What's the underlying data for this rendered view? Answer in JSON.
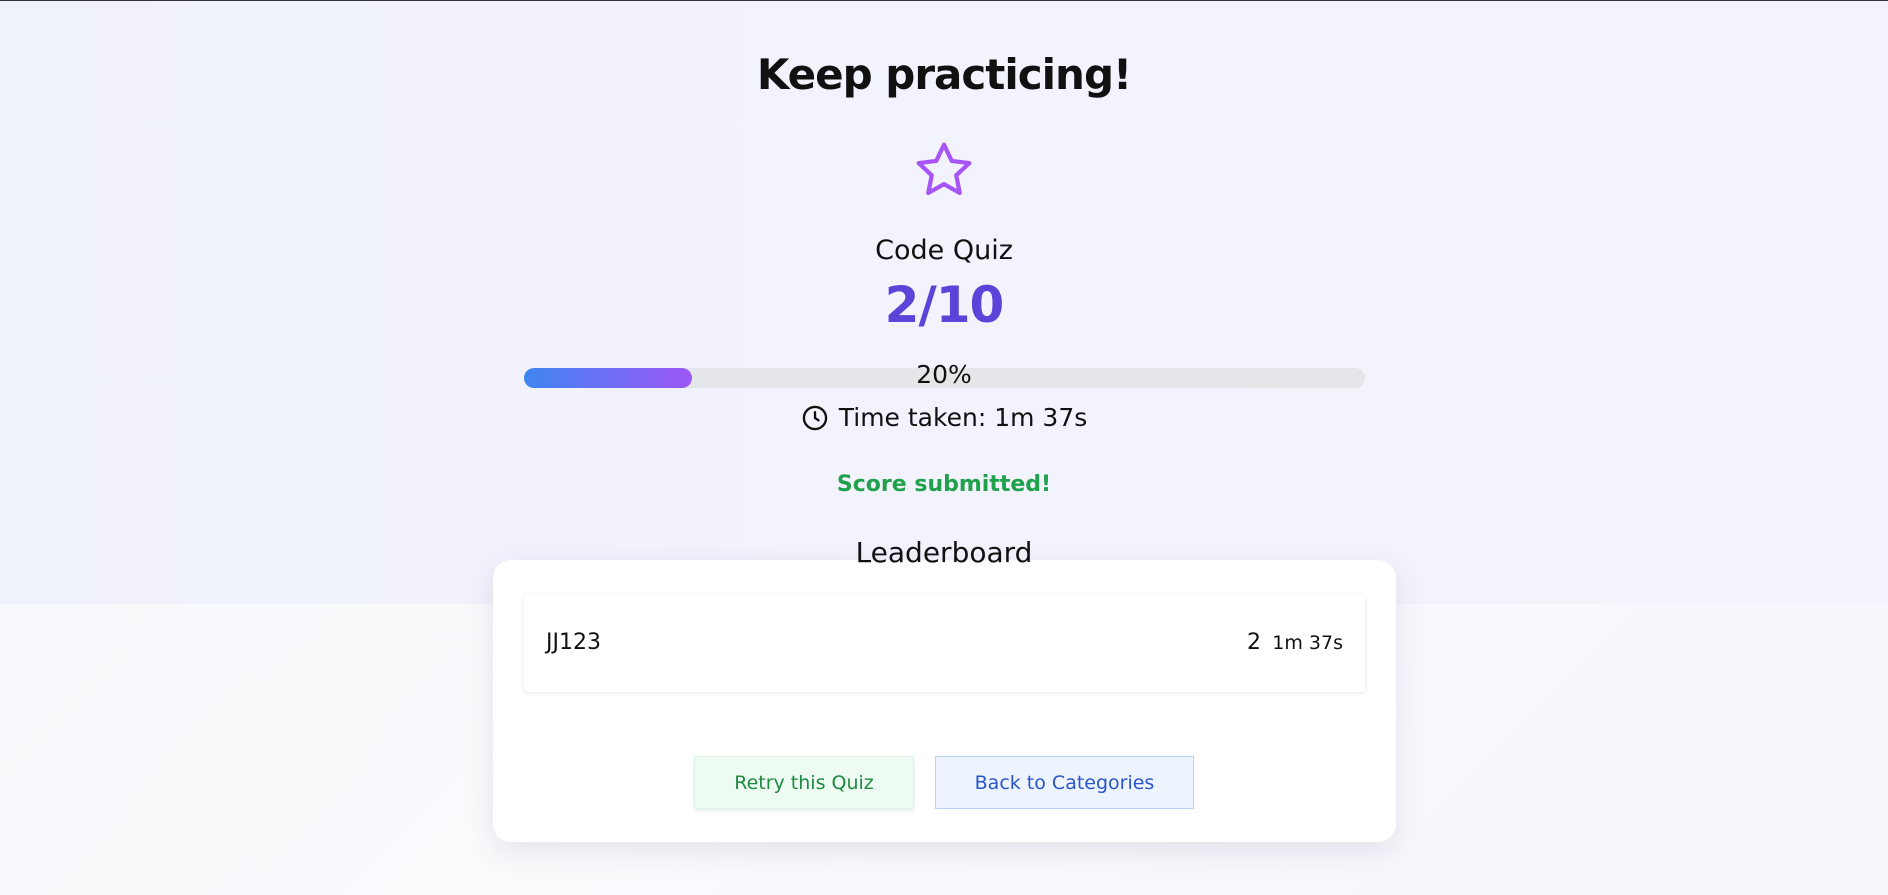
{
  "result": {
    "headline": "Keep practicing!",
    "icon": "star-icon",
    "quiz_title": "Code Quiz",
    "score_text": "2/10",
    "progress": {
      "percent": 20,
      "label": "20%"
    },
    "time_prefix": "Time taken:",
    "time_value": "1m 37s",
    "status": "Score submitted!"
  },
  "leaderboard": {
    "title": "Leaderboard",
    "rows": [
      {
        "name": "JJ123",
        "score": "2",
        "time": "1m 37s"
      }
    ]
  },
  "actions": {
    "retry_label": "Retry this Quiz",
    "back_label": "Back to Categories"
  },
  "colors": {
    "accent": "#5b45d9",
    "star": "#a855f7",
    "success": "#1fa24b",
    "progress_start": "#3f86f3",
    "progress_end": "#9d57f5",
    "retry_text": "#1f8a42",
    "back_text": "#2a55c8"
  }
}
